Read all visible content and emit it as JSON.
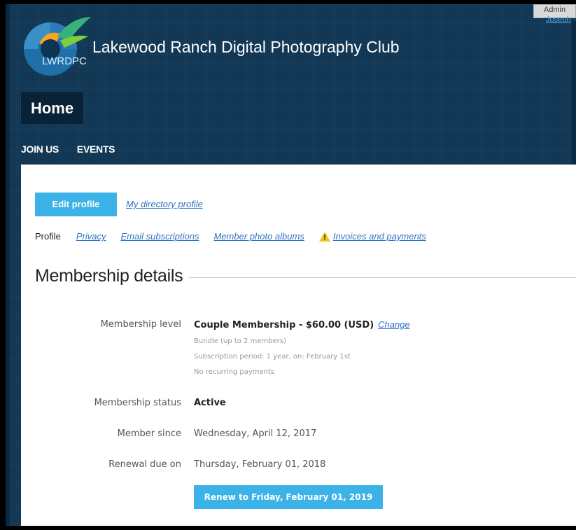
{
  "header": {
    "admin_label": "Admin",
    "user_link": "Joseph",
    "site_title": "Lakewood Ranch Digital Photography Club",
    "logo_text": "LWRDPC",
    "page_heading": "Home"
  },
  "nav": {
    "items": [
      "JOIN US",
      "EVENTS"
    ]
  },
  "profile": {
    "edit_profile_label": "Edit profile",
    "directory_link": "My directory profile",
    "tabs": {
      "current": "Profile",
      "privacy": "Privacy",
      "email": "Email subscriptions",
      "albums": "Member photo albums",
      "invoices": "Invoices and payments"
    }
  },
  "membership": {
    "section_title": "Membership details",
    "level_label": "Membership level",
    "level_value": "Couple Membership - $60.00 (USD)",
    "change_label": "Change",
    "notes": [
      "Bundle (up to 2 members)",
      "Subscription period: 1 year, on: February 1st",
      "No recurring payments"
    ],
    "status_label": "Membership status",
    "status_value": "Active",
    "since_label": "Member since",
    "since_value": "Wednesday, April 12, 2017",
    "renewal_label": "Renewal due on",
    "renewal_value": "Thursday, February 01, 2018",
    "renew_button": "Renew to Friday, February 01, 2019"
  },
  "colors": {
    "header_bg": "#0d3452",
    "button_accent": "#3bb2e8",
    "link": "#2f74c5",
    "warning": "#f5c518"
  },
  "icons": [
    "logo-camera-icon",
    "warning-icon"
  ]
}
